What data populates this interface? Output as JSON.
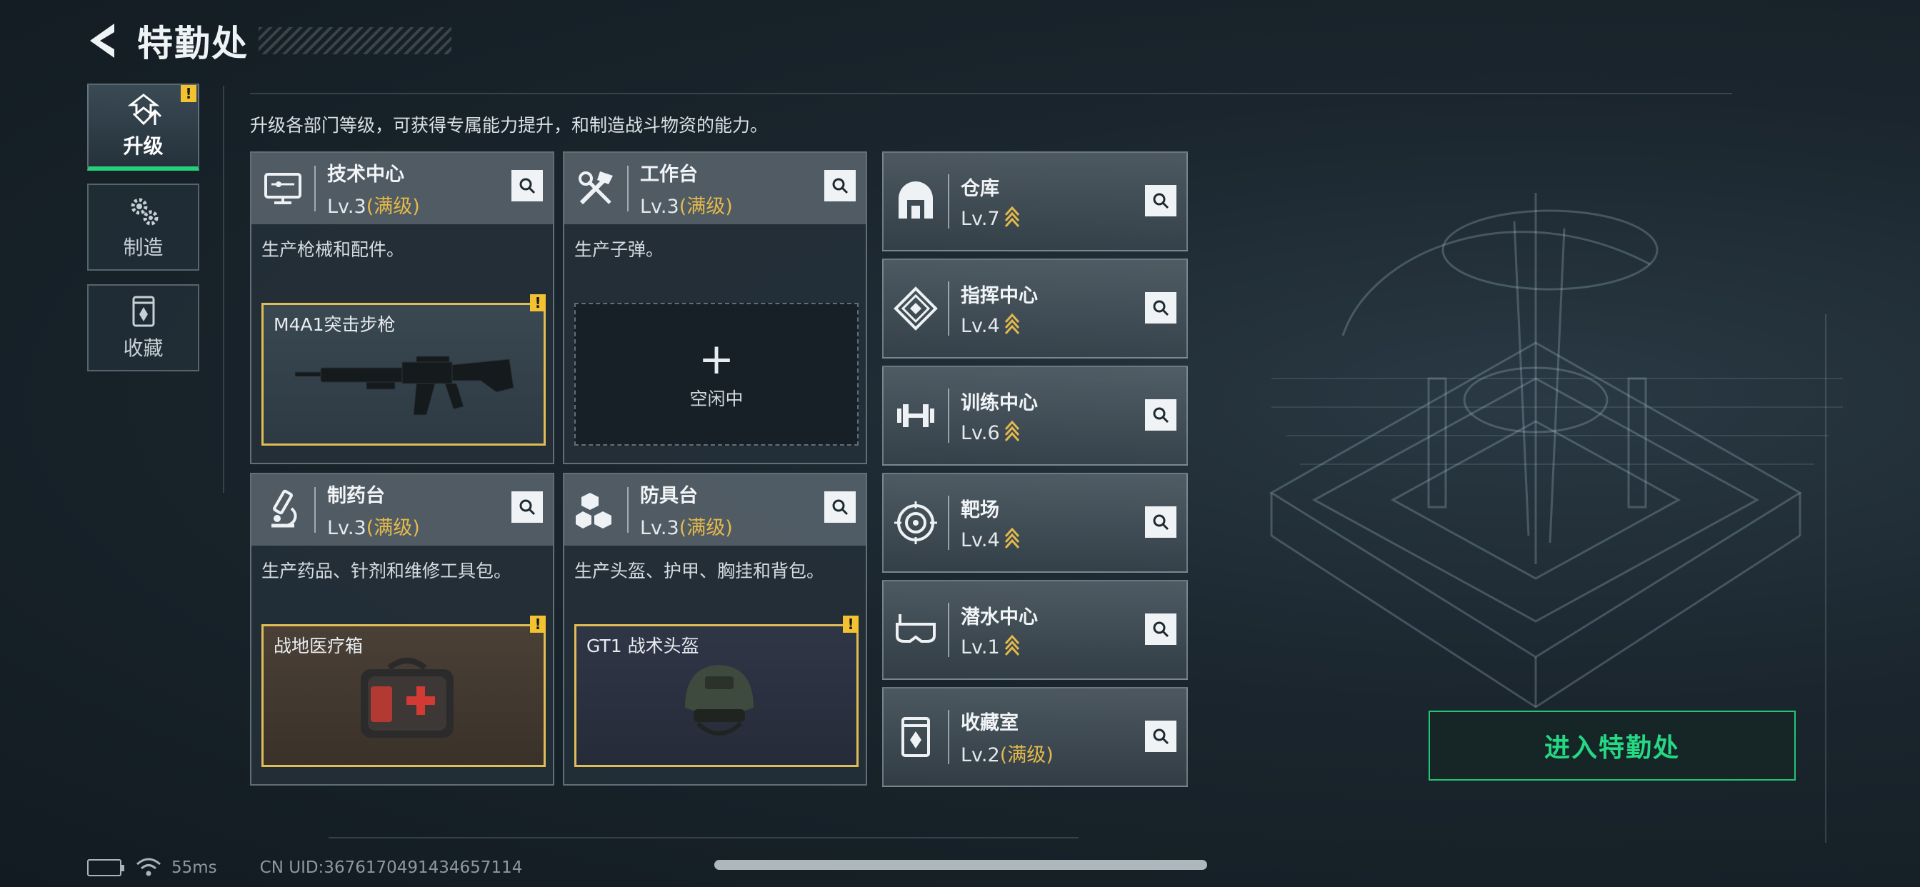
{
  "header": {
    "title": "特勤处"
  },
  "nav": [
    {
      "id": "upgrade",
      "label": "升级",
      "active": true,
      "alert": "!"
    },
    {
      "id": "craft",
      "label": "制造",
      "active": false
    },
    {
      "id": "collect",
      "label": "收藏",
      "active": false
    }
  ],
  "description": "升级各部门等级，可获得专属能力提升，和制造战斗物资的能力。",
  "cards": [
    {
      "name": "技术中心",
      "level": "Lv.3",
      "status": "(满级)",
      "desc": "生产枪械和配件。",
      "slot_label": "M4A1突击步枪",
      "alert": "!"
    },
    {
      "name": "工作台",
      "level": "Lv.3",
      "status": "(满级)",
      "desc": "生产子弹。",
      "slot_idle": "空闲中",
      "plus": "+"
    },
    {
      "name": "制药台",
      "level": "Lv.3",
      "status": "(满级)",
      "desc": "生产药品、针剂和维修工具包。",
      "slot_label": "战地医疗箱",
      "alert": "!"
    },
    {
      "name": "防具台",
      "level": "Lv.3",
      "status": "(满级)",
      "desc": "生产头盔、护甲、胸挂和背包。",
      "slot_label": "GT1 战术头盔",
      "alert": "!"
    }
  ],
  "facilities": [
    {
      "name": "仓库",
      "level": "Lv.7"
    },
    {
      "name": "指挥中心",
      "level": "Lv.4"
    },
    {
      "name": "训练中心",
      "level": "Lv.6"
    },
    {
      "name": "靶场",
      "level": "Lv.4"
    },
    {
      "name": "潜水中心",
      "level": "Lv.1"
    },
    {
      "name": "收藏室",
      "level": "Lv.2",
      "status": "(满级)"
    }
  ],
  "enter_button": "进入特勤处",
  "status_bar": {
    "ping": "55ms",
    "uid": "CN UID:3676170491434657114"
  },
  "colors": {
    "accent_green": "#25d884",
    "gold": "#e4b94b",
    "alert_yellow": "#f2c230"
  }
}
